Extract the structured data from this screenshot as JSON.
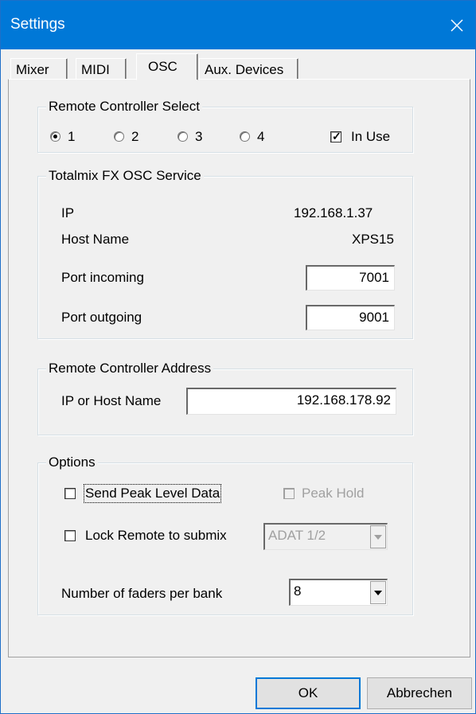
{
  "window": {
    "title": "Settings"
  },
  "tabs": [
    {
      "label": "Mixer"
    },
    {
      "label": "MIDI"
    },
    {
      "label": "OSC",
      "active": true
    },
    {
      "label": "Aux. Devices"
    }
  ],
  "remote_select": {
    "legend": "Remote Controller Select",
    "options": [
      "1",
      "2",
      "3",
      "4"
    ],
    "selected": "1",
    "in_use_label": "In Use",
    "in_use_checked": true
  },
  "osc_service": {
    "legend": "Totalmix FX OSC Service",
    "ip_label": "IP",
    "ip_value": "192.168.1.37",
    "host_label": "Host Name",
    "host_value": "XPS15",
    "port_in_label": "Port incoming",
    "port_in_value": "7001",
    "port_out_label": "Port outgoing",
    "port_out_value": "9001"
  },
  "remote_address": {
    "legend": "Remote Controller Address",
    "label": "IP or Host Name",
    "value": "192.168.178.92"
  },
  "options": {
    "legend": "Options",
    "send_peak_label": "Send Peak Level Data",
    "send_peak_checked": false,
    "peak_hold_label": "Peak Hold",
    "peak_hold_checked": false,
    "lock_remote_label": "Lock Remote to submix",
    "lock_remote_checked": false,
    "submix_value": "ADAT 1/2",
    "faders_label": "Number of faders per bank",
    "faders_value": "8"
  },
  "buttons": {
    "ok": "OK",
    "cancel": "Abbrechen"
  },
  "colors": {
    "titlebar": "#0078d7",
    "dialog_bg": "#f0f0f0",
    "disabled_text": "#a0a0a0"
  }
}
